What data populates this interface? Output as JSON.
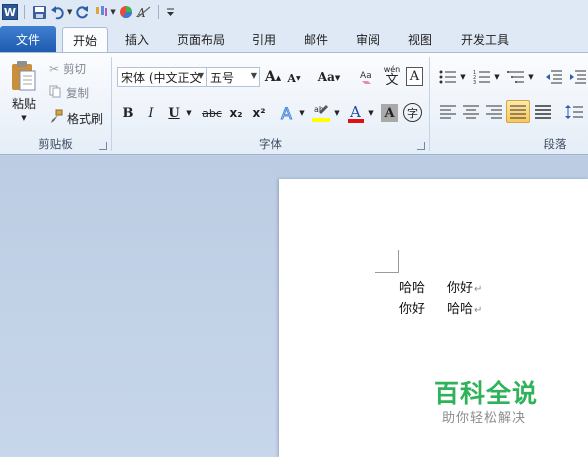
{
  "quick_access": {
    "app_logo": "W",
    "icons": [
      "word-logo-icon",
      "save-icon",
      "undo-icon",
      "redo-icon",
      "format-painter-icon",
      "color-icon",
      "clear-format-icon",
      "customize-toolbar-icon"
    ]
  },
  "tabs": [
    {
      "label": "文件"
    },
    {
      "label": "开始"
    },
    {
      "label": "插入"
    },
    {
      "label": "页面布局"
    },
    {
      "label": "引用"
    },
    {
      "label": "邮件"
    },
    {
      "label": "审阅"
    },
    {
      "label": "视图"
    },
    {
      "label": "开发工具"
    }
  ],
  "clipboard": {
    "paste_label": "粘贴",
    "cut_label": "剪切",
    "copy_label": "复制",
    "format_painter_label": "格式刷",
    "group_label": "剪贴板"
  },
  "font": {
    "font_name": "宋体 (中文正文",
    "font_size": "五号",
    "group_label": "字体",
    "grow_label": "A",
    "shrink_label": "A",
    "case_label": "Aa",
    "phonetic_label": "wén",
    "bold": "B",
    "italic": "I",
    "underline": "U",
    "strike": "abc",
    "subscript": "x₂",
    "superscript": "x²",
    "highlight_color": "#ffff00",
    "font_color": "#e01010"
  },
  "paragraph": {
    "group_label": "段落"
  },
  "document": {
    "lines": [
      {
        "col1": "哈哈",
        "col2": "你好"
      },
      {
        "col1": "你好",
        "col2": "哈哈"
      }
    ],
    "paragraph_mark": "↵"
  },
  "watermark": {
    "title": "百科全说",
    "subtitle": "助你轻松解决",
    "title_color": "#2fb35a"
  }
}
